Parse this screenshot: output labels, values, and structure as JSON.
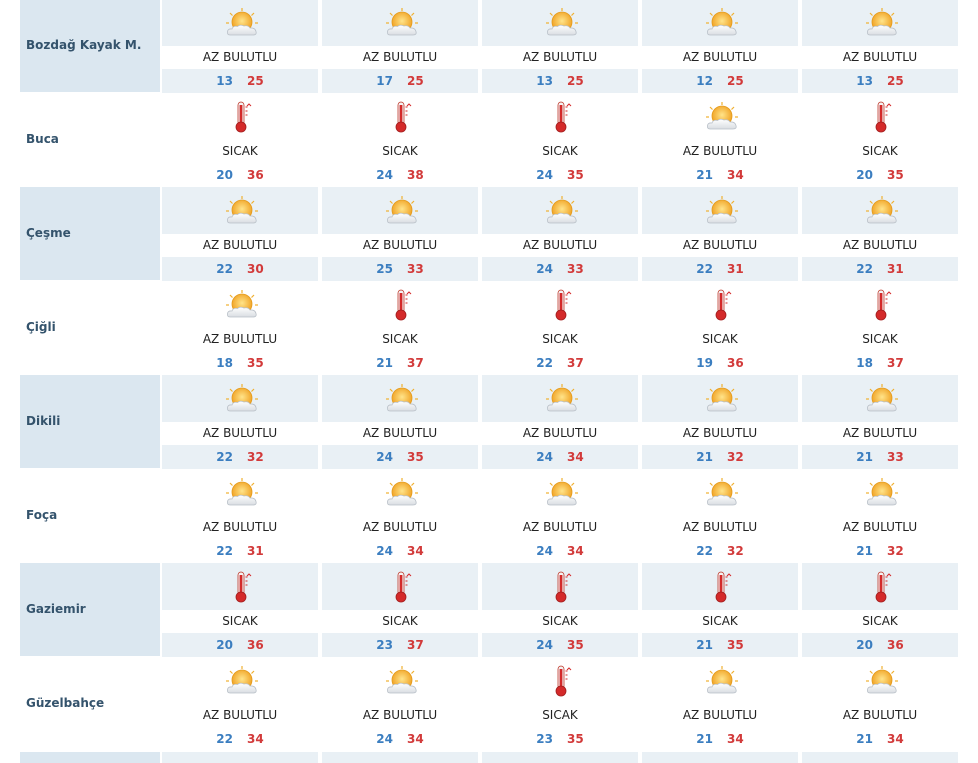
{
  "rows": [
    {
      "name": "Bozdağ Kayak M.",
      "days": [
        {
          "icon": "partly-cloudy-icon",
          "cond": "AZ BULUTLU",
          "min": "13",
          "max": "25"
        },
        {
          "icon": "partly-cloudy-icon",
          "cond": "AZ BULUTLU",
          "min": "17",
          "max": "25"
        },
        {
          "icon": "partly-cloudy-icon",
          "cond": "AZ BULUTLU",
          "min": "13",
          "max": "25"
        },
        {
          "icon": "partly-cloudy-icon",
          "cond": "AZ BULUTLU",
          "min": "12",
          "max": "25"
        },
        {
          "icon": "partly-cloudy-icon",
          "cond": "AZ BULUTLU",
          "min": "13",
          "max": "25"
        }
      ]
    },
    {
      "name": "Buca",
      "days": [
        {
          "icon": "thermometer-icon",
          "cond": "SICAK",
          "min": "20",
          "max": "36"
        },
        {
          "icon": "thermometer-icon",
          "cond": "SICAK",
          "min": "24",
          "max": "38"
        },
        {
          "icon": "thermometer-icon",
          "cond": "SICAK",
          "min": "24",
          "max": "35"
        },
        {
          "icon": "partly-cloudy-icon",
          "cond": "AZ BULUTLU",
          "min": "21",
          "max": "34"
        },
        {
          "icon": "thermometer-icon",
          "cond": "SICAK",
          "min": "20",
          "max": "35"
        }
      ]
    },
    {
      "name": "Çeşme",
      "days": [
        {
          "icon": "partly-cloudy-icon",
          "cond": "AZ BULUTLU",
          "min": "22",
          "max": "30"
        },
        {
          "icon": "partly-cloudy-icon",
          "cond": "AZ BULUTLU",
          "min": "25",
          "max": "33"
        },
        {
          "icon": "partly-cloudy-icon",
          "cond": "AZ BULUTLU",
          "min": "24",
          "max": "33"
        },
        {
          "icon": "partly-cloudy-icon",
          "cond": "AZ BULUTLU",
          "min": "22",
          "max": "31"
        },
        {
          "icon": "partly-cloudy-icon",
          "cond": "AZ BULUTLU",
          "min": "22",
          "max": "31"
        }
      ]
    },
    {
      "name": "Çiğli",
      "days": [
        {
          "icon": "partly-cloudy-icon",
          "cond": "AZ BULUTLU",
          "min": "18",
          "max": "35"
        },
        {
          "icon": "thermometer-icon",
          "cond": "SICAK",
          "min": "21",
          "max": "37"
        },
        {
          "icon": "thermometer-icon",
          "cond": "SICAK",
          "min": "22",
          "max": "37"
        },
        {
          "icon": "thermometer-icon",
          "cond": "SICAK",
          "min": "19",
          "max": "36"
        },
        {
          "icon": "thermometer-icon",
          "cond": "SICAK",
          "min": "18",
          "max": "37"
        }
      ]
    },
    {
      "name": "Dikili",
      "days": [
        {
          "icon": "partly-cloudy-icon",
          "cond": "AZ BULUTLU",
          "min": "22",
          "max": "32"
        },
        {
          "icon": "partly-cloudy-icon",
          "cond": "AZ BULUTLU",
          "min": "24",
          "max": "35"
        },
        {
          "icon": "partly-cloudy-icon",
          "cond": "AZ BULUTLU",
          "min": "24",
          "max": "34"
        },
        {
          "icon": "partly-cloudy-icon",
          "cond": "AZ BULUTLU",
          "min": "21",
          "max": "32"
        },
        {
          "icon": "partly-cloudy-icon",
          "cond": "AZ BULUTLU",
          "min": "21",
          "max": "33"
        }
      ]
    },
    {
      "name": "Foça",
      "days": [
        {
          "icon": "partly-cloudy-icon",
          "cond": "AZ BULUTLU",
          "min": "22",
          "max": "31"
        },
        {
          "icon": "partly-cloudy-icon",
          "cond": "AZ BULUTLU",
          "min": "24",
          "max": "34"
        },
        {
          "icon": "partly-cloudy-icon",
          "cond": "AZ BULUTLU",
          "min": "24",
          "max": "34"
        },
        {
          "icon": "partly-cloudy-icon",
          "cond": "AZ BULUTLU",
          "min": "22",
          "max": "32"
        },
        {
          "icon": "partly-cloudy-icon",
          "cond": "AZ BULUTLU",
          "min": "21",
          "max": "32"
        }
      ]
    },
    {
      "name": "Gaziemir",
      "days": [
        {
          "icon": "thermometer-icon",
          "cond": "SICAK",
          "min": "20",
          "max": "36"
        },
        {
          "icon": "thermometer-icon",
          "cond": "SICAK",
          "min": "23",
          "max": "37"
        },
        {
          "icon": "thermometer-icon",
          "cond": "SICAK",
          "min": "24",
          "max": "35"
        },
        {
          "icon": "thermometer-icon",
          "cond": "SICAK",
          "min": "21",
          "max": "35"
        },
        {
          "icon": "thermometer-icon",
          "cond": "SICAK",
          "min": "20",
          "max": "36"
        }
      ]
    },
    {
      "name": "Güzelbahçe",
      "days": [
        {
          "icon": "partly-cloudy-icon",
          "cond": "AZ BULUTLU",
          "min": "22",
          "max": "34"
        },
        {
          "icon": "partly-cloudy-icon",
          "cond": "AZ BULUTLU",
          "min": "24",
          "max": "34"
        },
        {
          "icon": "thermometer-icon",
          "cond": "SICAK",
          "min": "23",
          "max": "35"
        },
        {
          "icon": "partly-cloudy-icon",
          "cond": "AZ BULUTLU",
          "min": "21",
          "max": "34"
        },
        {
          "icon": "partly-cloudy-icon",
          "cond": "AZ BULUTLU",
          "min": "21",
          "max": "34"
        }
      ]
    }
  ],
  "colors": {
    "min_temp": "#3b7ec0",
    "max_temp": "#d23a3a",
    "city": "#34536c",
    "shade": "#e9f0f5"
  }
}
